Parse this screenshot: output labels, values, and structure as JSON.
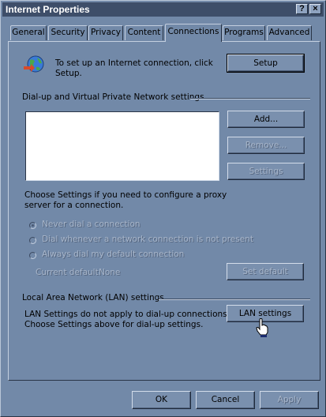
{
  "window": {
    "title": "Internet Properties",
    "help_button": "?",
    "close_button": "×"
  },
  "tabs": [
    {
      "label": "General"
    },
    {
      "label": "Security"
    },
    {
      "label": "Privacy"
    },
    {
      "label": "Content"
    },
    {
      "label": "Connections",
      "active": true
    },
    {
      "label": "Programs"
    },
    {
      "label": "Advanced"
    }
  ],
  "setup": {
    "text_line1": "To set up an Internet connection, click",
    "text_line2": "Setup.",
    "button": "Setup"
  },
  "dialup": {
    "group_label": "Dial-up and Virtual Private Network settings",
    "add_button": "Add...",
    "remove_button": "Remove...",
    "settings_button": "Settings",
    "info_line1": "Choose Settings if you need to configure a proxy",
    "info_line2": "server for a connection.",
    "radio_never": "Never dial a connection",
    "radio_whenever": "Dial whenever a network connection is not present",
    "radio_always": "Always dial my default connection",
    "current_default_label": "Current default:",
    "current_default_value": "None",
    "set_default_button": "Set default"
  },
  "lan": {
    "group_label": "Local Area Network (LAN) settings",
    "info_line1": "LAN Settings do not apply to dial-up connections.",
    "info_line2": "Choose Settings above for dial-up settings.",
    "button": "LAN settings"
  },
  "footer": {
    "ok": "OK",
    "cancel": "Cancel",
    "apply": "Apply"
  },
  "colors": {
    "window_bg": "#7289a8",
    "titlebar": "#3e4e69",
    "listbox": "#ffffff"
  }
}
